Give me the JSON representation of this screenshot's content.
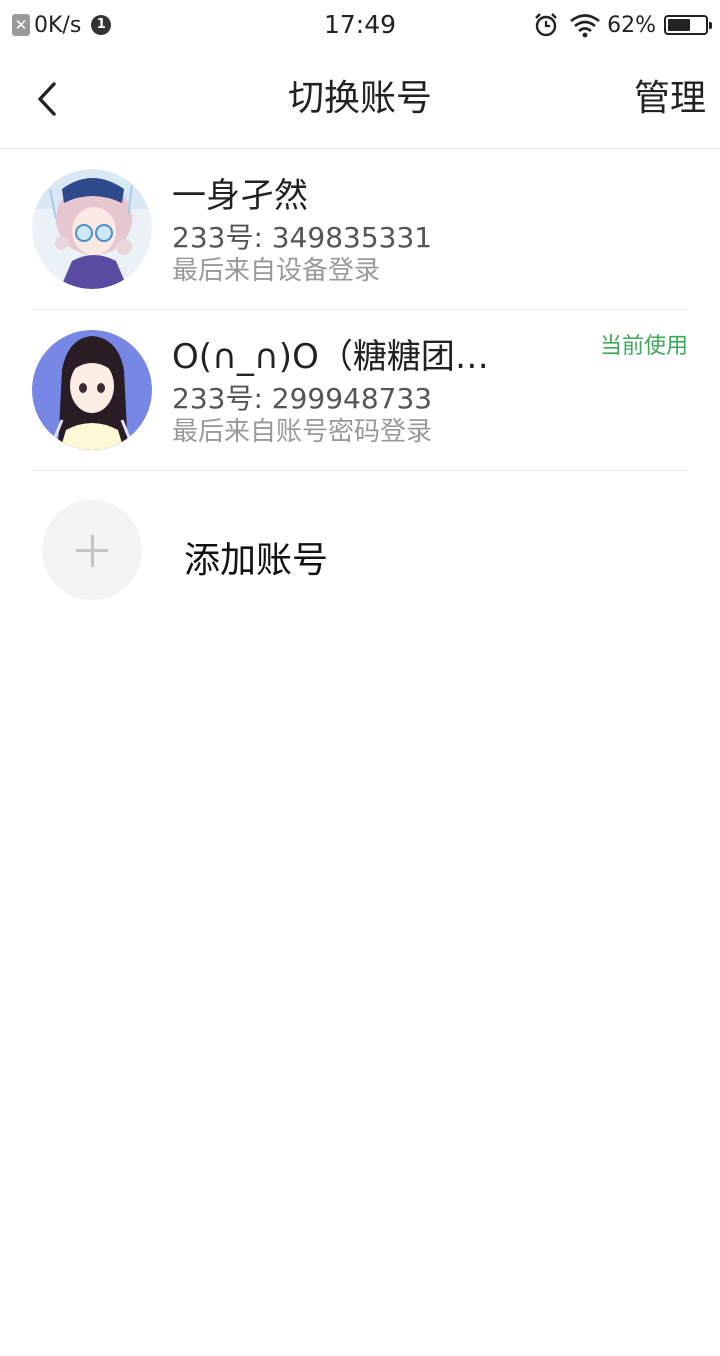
{
  "status_bar": {
    "speed": "0K/s",
    "notification_count": "1",
    "time": "17:49",
    "battery_percent": "62%",
    "battery_level": 0.62,
    "icons": [
      "blocked-box-icon",
      "alarm-icon",
      "wifi-icon",
      "battery-icon"
    ]
  },
  "nav": {
    "back_icon": "chevron-left-icon",
    "title": "切换账号",
    "manage_label": "管理"
  },
  "accounts": [
    {
      "name": "一身孑然",
      "id_line": "233号: 349835331",
      "last_login": "最后来自设备登录",
      "current_label": ""
    },
    {
      "name": "O(∩_∩)O（糖糖团…",
      "id_line": "233号: 299948733",
      "last_login": "最后来自账号密码登录",
      "current_label": "当前使用"
    }
  ],
  "add_account": {
    "label": "添加账号",
    "icon": "plus-icon"
  },
  "colors": {
    "current_green": "#3daa5a",
    "divider": "#ececec",
    "muted_text": "#999999"
  }
}
